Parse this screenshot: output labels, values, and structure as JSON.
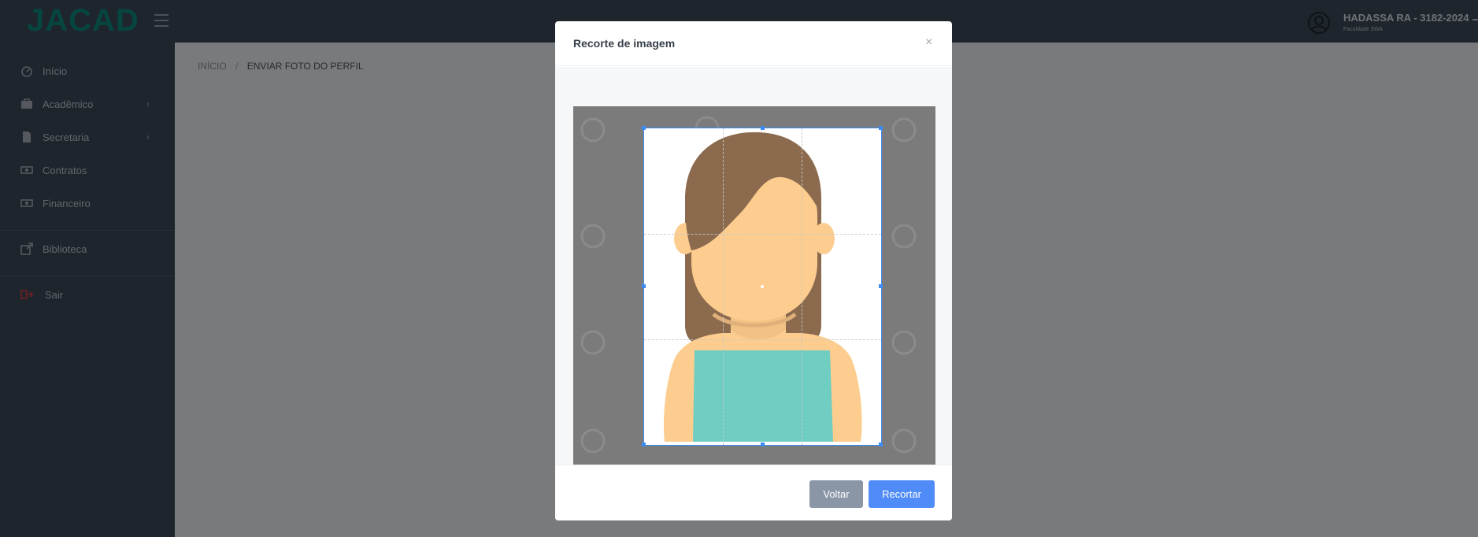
{
  "brand": {
    "logo_text": "JACAD",
    "logo_color": "#0c8a80"
  },
  "header": {
    "user_name": "HADASSA RA - 3182-2024",
    "user_subtitle": "Faculdade SWA"
  },
  "sidebar": {
    "items": [
      {
        "label": "Início",
        "icon": "dashboard-icon"
      },
      {
        "label": "Acadêmico",
        "icon": "briefcase-icon",
        "has_submenu": true
      },
      {
        "label": "Secretaria",
        "icon": "document-icon",
        "has_submenu": true
      },
      {
        "label": "Contratos",
        "icon": "money-icon"
      },
      {
        "label": "Financeiro",
        "icon": "money-icon"
      },
      {
        "label": "Biblioteca",
        "icon": "external-link-icon"
      },
      {
        "label": "Sair",
        "icon": "logout-icon",
        "color": "#d64545"
      }
    ]
  },
  "breadcrumb": {
    "home": "INÍCIO",
    "separator": "/",
    "current": "ENVIAR FOTO DO PERFIL"
  },
  "modal": {
    "title": "Recorte de imagem",
    "close_glyph": "×",
    "buttons": {
      "back": "Voltar",
      "crop": "Recortar"
    }
  },
  "colors": {
    "sidebar_bg": "#3d4a5a",
    "crop_outline": "#3c8cf5",
    "primary_button": "#4f8cf7",
    "secondary_button": "#8a96a6",
    "hair": "#8b6a4e",
    "skin": "#fccd8f",
    "shirt": "#6fcdc2"
  }
}
